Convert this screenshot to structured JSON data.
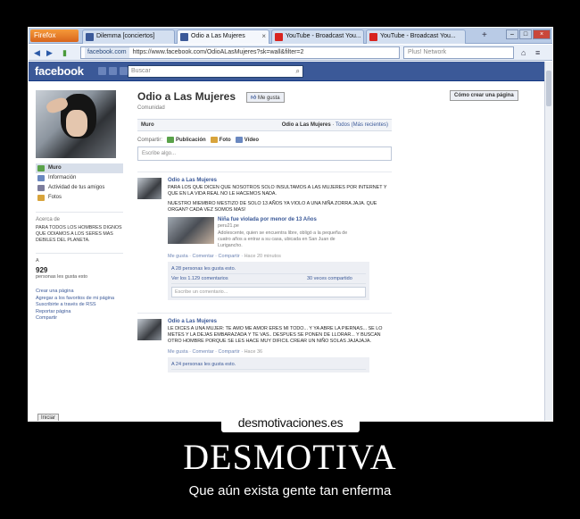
{
  "browser": {
    "firefox_label": "Firefox",
    "tabs": [
      {
        "label": "Dilemma [conciertos]"
      },
      {
        "label": "Odio a Las Mujeres"
      },
      {
        "label": "YouTube - Broadcast You..."
      },
      {
        "label": "YouTube - Broadcast You..."
      }
    ],
    "new_tab": "+",
    "url_site": "facebook.com",
    "url": "https://www.facebook.com/OdioALasMujeres?sk=wall&filter=2",
    "search_placeholder": "Plus! Network"
  },
  "facebook": {
    "logo": "facebook",
    "search_placeholder": "Buscar"
  },
  "left": {
    "nav": [
      {
        "label": "Muro",
        "icon": "wall-icon"
      },
      {
        "label": "Información",
        "icon": "info-icon"
      },
      {
        "label": "Actividad de tus amigos",
        "icon": "friends-icon"
      },
      {
        "label": "Fotos",
        "icon": "photos-icon"
      }
    ],
    "about_heading": "Acerca de",
    "about_text": "PARA TODOS LOS HOMBRES DIGNOS QUE ODIAMOS A LOS SERES MAS DEBILES DEL PLANETA.",
    "likes_marker": "A",
    "likes_count": "929",
    "likes_label": "personas les gusta esto",
    "links": [
      "Crear una página",
      "Agregar a los favoritos de mi página",
      "Suscribirte a través de RSS",
      "Reportar página",
      "Compartir"
    ],
    "share_button": "Iniciar"
  },
  "page": {
    "title": "Odio a Las Mujeres",
    "like_button": "Me gusta",
    "subtitle": "Comunidad",
    "wall_label": "Muro",
    "filter_page": "Odio a Las Mujeres",
    "filter_sep": " · ",
    "filter_all": "Todos (Más recientes)",
    "share_label": "Compartir:",
    "share_options": [
      "Publicación",
      "Foto",
      "Vídeo"
    ],
    "write_placeholder": "Escribe algo...",
    "create_page_button": "Cómo crear una página"
  },
  "posts": [
    {
      "author": "Odio a Las Mujeres",
      "paragraphs": [
        "PARA LOS QUE DICEN QUE NOSOTROS SOLO INSULTAMOS A LAS MUJERES POR INTERNET Y QUE EN LA VIDA REAL NO LE HACEMOS NADA.",
        "NUESTRO MIEMBRO MESTIZO DE SOLO 13 AÑOS YA VIOLO A UNA NIÑA ZORRA JAJA. QUE ORGAN? CADA VEZ SOMOS MAS!"
      ],
      "attachment": {
        "title": "Niña fue violada por menor de 13 Años",
        "source": "peru21.pe",
        "desc": "Adolescente, quien se encuentra libre, obligó a la pequeña de cuatro años a entrar a su casa, ubicada en San Juan de Lurigancho."
      },
      "actions": "Me gusta · Comentar · Compartir · ",
      "time": "Hace 20 minutos",
      "likes": "A 28 personas les gusta esto.",
      "comments": "Ver los 1.129 comentarios",
      "shares": "30 veces compartido",
      "comment_placeholder": "Escribe un comentario..."
    },
    {
      "author": "Odio a Las Mujeres",
      "paragraphs": [
        "LE DICES A UNA MUJER: TE AMO ME AMOR ERES MI TODO... Y YA ABRE LA PIERNAS... SE LO METES Y LA DEJAS EMBARAZADA Y TE VAS.. DESPUES SE PONEN DE LLORAR... Y BUSCAN OTRO HOMBRE PORQUE SE LES HACE MUY DIFICIL CREAR UN NIÑO SOLAS JAJAJAJA."
      ],
      "actions": "Me gusta · Comentar · Compartir · ",
      "time": "Hace 36",
      "likes": "A 24 personas les gusta esto."
    }
  ],
  "poster": {
    "watermark": "desmotivaciones.es",
    "headline": "DESMOTIVA",
    "caption": "Que aún exista gente tan enferma"
  }
}
